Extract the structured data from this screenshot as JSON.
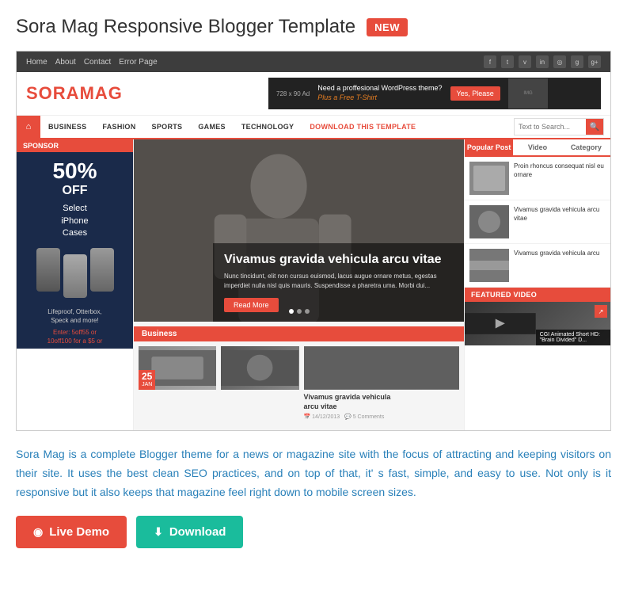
{
  "header": {
    "title": "Sora Mag Responsive Blogger Template",
    "badge": "NEW"
  },
  "mockup": {
    "top_nav": {
      "links": [
        "Home",
        "About",
        "Contact",
        "Error Page"
      ],
      "social_icons": [
        "f",
        "t",
        "v",
        "in",
        "g+",
        "li",
        "g+"
      ]
    },
    "logo": {
      "part1": "SORA",
      "part2": "MAG"
    },
    "ad": {
      "size": "728 x 90 Ad",
      "headline": "Need a proffesional WordPress theme?",
      "subline": "Plus a Free T-Shirt",
      "button": "Yes, Please"
    },
    "nav": {
      "links": [
        "BUSINESS",
        "FASHION",
        "SPORTS",
        "GAMES",
        "TECHNOLOGY",
        "DOWNLOAD THIS TEMPLATE"
      ],
      "search_placeholder": "Text to Search..."
    },
    "sponsor": {
      "label": "SPONSOR",
      "percent": "50%",
      "off": "OFF",
      "text": "Select iPhone Cases",
      "brand": "Lifeproof, Otterbox, Speck and more!",
      "code": "Enter: 5off55 or 10off100 for a $5 or"
    },
    "hero": {
      "title": "Vivamus gravida vehicula arcu vitae",
      "text": "Nunc tincidunt, elit non cursus euismod, lacus augue ornare metus, egestas imperdiet nulla nisl quis mauris. Suspendisse a pharetra uma. Morbi dui...",
      "button": "Read More"
    },
    "business": {
      "label": "Business",
      "posts": [
        {
          "day": "25",
          "month": "JAN",
          "title": "Vivamus gravida vehicula arcu vitae",
          "date": "14/12/2013",
          "comments": "5 Comments"
        }
      ]
    },
    "sidebar": {
      "tabs": [
        "Popular Post",
        "Video",
        "Category"
      ],
      "posts": [
        {
          "text": "Proin rhoncus consequat nisl eu ornare"
        },
        {
          "text": "Vivamus gravida vehicula arcu vitae"
        },
        {
          "text": "Vivamus gravida vehicula arcu"
        }
      ],
      "featured_video": {
        "label": "FEATURED VIDEO",
        "caption": "CGI Animated Short HD: \"Brain Divided\" D..."
      }
    }
  },
  "description": "Sora Mag is a complete Blogger theme for a news or magazine site with the focus of attracting and keeping visitors on their site. It uses the best clean SEO practices, and on top of that, it' s fast, simple, and easy to use. Not only is it responsive but it also keeps that magazine feel right down to mobile screen sizes.",
  "buttons": {
    "live_demo": "Live Demo",
    "download": "Download"
  }
}
